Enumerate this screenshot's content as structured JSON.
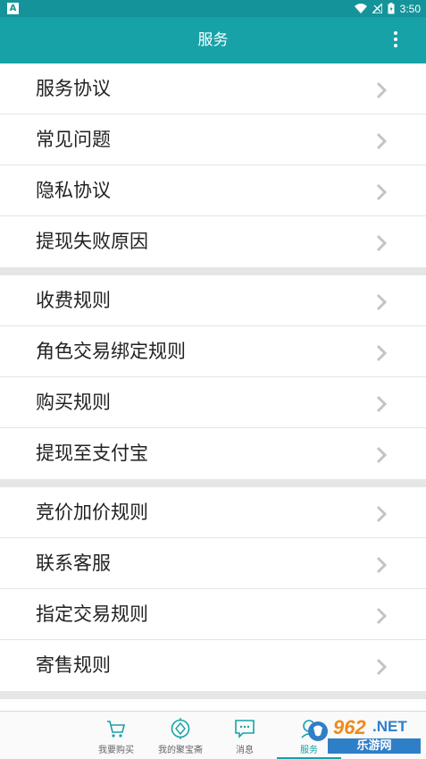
{
  "status_bar": {
    "app_badge": "A",
    "time": "3:50",
    "icons": [
      "wifi-icon",
      "signal-icon",
      "battery-icon"
    ]
  },
  "app_bar": {
    "title": "服务",
    "menu_icon": "more-vert-icon"
  },
  "groups": [
    {
      "items": [
        {
          "label": "服务协议"
        },
        {
          "label": "常见问题"
        },
        {
          "label": "隐私协议"
        },
        {
          "label": "提现失败原因"
        }
      ]
    },
    {
      "items": [
        {
          "label": "收费规则"
        },
        {
          "label": "角色交易绑定规则"
        },
        {
          "label": "购买规则"
        },
        {
          "label": "提现至支付宝"
        }
      ]
    },
    {
      "items": [
        {
          "label": "竞价加价规则"
        },
        {
          "label": "联系客服"
        },
        {
          "label": "指定交易规则"
        },
        {
          "label": "寄售规则"
        }
      ]
    }
  ],
  "tabs": [
    {
      "label": "我要购买",
      "icon": "cart-icon"
    },
    {
      "label": "我的聚宝斋",
      "icon": "compass-icon"
    },
    {
      "label": "消息",
      "icon": "message-icon"
    },
    {
      "label": "服务",
      "icon": "service-icon",
      "active": true
    }
  ],
  "watermark": {
    "num": "962",
    "net": ".NET",
    "site": "乐游网"
  },
  "colors": {
    "accent": "#17a2a8",
    "status_bar": "#14949a",
    "divider": "#e6e6e6"
  }
}
